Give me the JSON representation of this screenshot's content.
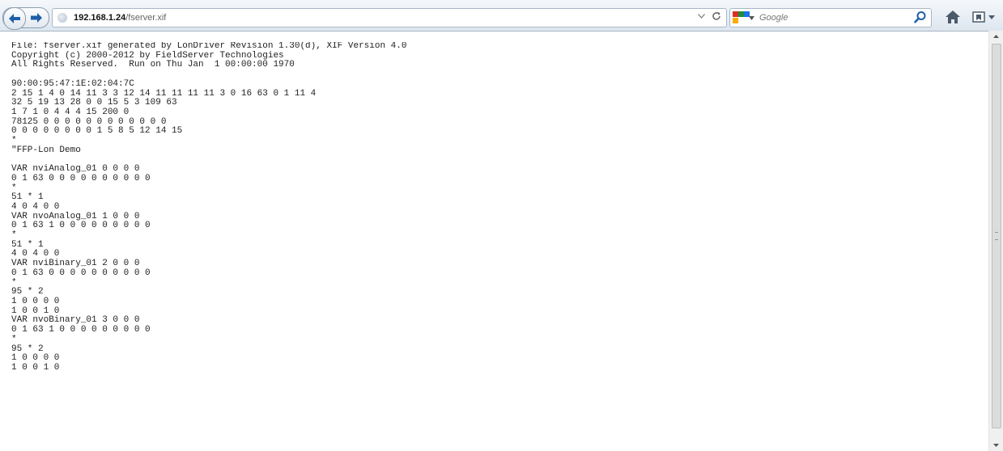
{
  "browser": {
    "url_host": "192.168.1.24",
    "url_path": "/fserver.xif",
    "search_placeholder": "Google"
  },
  "icons": {
    "back": "back-arrow-icon",
    "forward": "forward-arrow-icon",
    "site": "site-identity-icon",
    "dropdown": "chevron-down-icon",
    "reload": "reload-icon",
    "search_engine": "google-logo-icon",
    "search": "search-icon",
    "home": "home-icon",
    "bookmarks": "bookmarks-icon"
  },
  "colors": {
    "accent": "#1f5fa8",
    "google_red": "#d93025",
    "google_green": "#1e8e3e",
    "google_blue": "#1a73e8",
    "google_yellow": "#f9ab00"
  },
  "document": {
    "text": "File: fserver.xif generated by LonDriver Revision 1.30(d), XIF Version 4.0\nCopyright (c) 2000-2012 by FieldServer Technologies\nAll Rights Reserved.  Run on Thu Jan  1 00:00:00 1970\n\n90:00:95:47:1E:02:04:7C\n2 15 1 4 0 14 11 3 3 12 14 11 11 11 11 3 0 16 63 0 1 11 4\n32 5 19 13 28 0 0 15 5 3 109 63\n1 7 1 0 4 4 4 15 200 0\n78125 0 0 0 0 0 0 0 0 0 0 0 0\n0 0 0 0 0 0 0 0 1 5 8 5 12 14 15\n*\n\"FFP-Lon Demo\n\nVAR nviAnalog_01 0 0 0 0\n0 1 63 0 0 0 0 0 0 0 0 0 0\n*\n51 * 1\n4 0 4 0 0\nVAR nvoAnalog_01 1 0 0 0\n0 1 63 1 0 0 0 0 0 0 0 0 0\n*\n51 * 1\n4 0 4 0 0\nVAR nviBinary_01 2 0 0 0\n0 1 63 0 0 0 0 0 0 0 0 0 0\n*\n95 * 2\n1 0 0 0 0\n1 0 0 1 0\nVAR nvoBinary_01 3 0 0 0\n0 1 63 1 0 0 0 0 0 0 0 0 0\n*\n95 * 2\n1 0 0 0 0\n1 0 0 1 0"
  }
}
